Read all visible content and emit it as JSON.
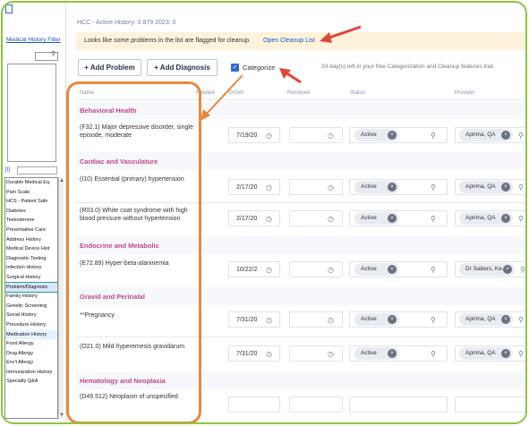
{
  "left_panel": {
    "link": "Medical History Filter",
    "at_label": "[t]",
    "items": [
      {
        "label": "Durable Medical Eq.",
        "state": "normal"
      },
      {
        "label": "Pain Scale",
        "state": "normal"
      },
      {
        "label": "HCS - Patient Safe",
        "state": "normal"
      },
      {
        "label": "Diabetes",
        "state": "normal"
      },
      {
        "label": "Testosterone",
        "state": "normal"
      },
      {
        "label": "Preventative Care",
        "state": "normal"
      },
      {
        "label": "Address History",
        "state": "normal"
      },
      {
        "label": "Medical Device Hist",
        "state": "normal"
      },
      {
        "label": "Diagnostic Testing",
        "state": "normal"
      },
      {
        "label": "Infection History",
        "state": "normal"
      },
      {
        "label": "Surgical History",
        "state": "normal"
      },
      {
        "label": "Problem/Diagnosis",
        "state": "selected"
      },
      {
        "label": "Family History",
        "state": "normal"
      },
      {
        "label": "Genetic Screening",
        "state": "normal"
      },
      {
        "label": "Social History",
        "state": "normal"
      },
      {
        "label": "Procedure History",
        "state": "normal"
      },
      {
        "label": "Medication History",
        "state": "highlight"
      },
      {
        "label": "Food Allergy",
        "state": "normal"
      },
      {
        "label": "Drug Allergy",
        "state": "normal"
      },
      {
        "label": "Env't Allergy",
        "state": "normal"
      },
      {
        "label": "Immunization History",
        "state": "normal"
      },
      {
        "label": "Specialty Q&A",
        "state": "normal"
      }
    ]
  },
  "header": {
    "hcc": "HCC - Active History: 0.879  2023: 0",
    "banner_text": "Looks like some problems in the list are flagged for cleanup.",
    "banner_link": "Open Cleanup List",
    "add_problem": "+ Add Problem",
    "add_diagnosis": "+ Add Diagnosis",
    "categorize": "Categorize",
    "trial_text": "33 day(s) left in your free Categorization and Cleanup features trial."
  },
  "columns": {
    "name": "Name",
    "related": "Related",
    "onset": "OnSet",
    "resolved": "Resolved",
    "status": "Status",
    "provider": "Provider"
  },
  "categories": [
    {
      "name": "Behavioral Health"
    },
    {
      "name": "Cardiac and Vasculature"
    },
    {
      "name": "Endocrine and Metabolic"
    },
    {
      "name": "Gravid and Perinatal"
    },
    {
      "name": "Hematology and Neoplasia"
    }
  ],
  "rows": [
    {
      "dx": "(F32.1) Major depressive disorder, single episode, moderate",
      "onset": "7/19/20",
      "status": "Active",
      "provider": "Aprima, QA"
    },
    {
      "dx": "(I10) Essential (primary) hypertension",
      "onset": "2/17/20",
      "status": "Active",
      "provider": "Aprima, QA"
    },
    {
      "dx": "(R03.0) White coat syndrome with high blood pressure without hypertension",
      "onset": "2/17/20",
      "status": "Active",
      "provider": "Aprima, QA"
    },
    {
      "dx": "(E72.89) Hyper-beta-alaninemia",
      "onset": "10/22/2",
      "status": "Active",
      "provider": "Dr Sabers, Ke..."
    },
    {
      "dx": "**Pregnancy",
      "onset": "7/31/20",
      "status": "Active",
      "provider": "Aprima, QA"
    },
    {
      "dx": "(O21.0) Mild hyperemesis gravidarum",
      "onset": "7/31/20",
      "status": "Active",
      "provider": "Aprima, QA"
    },
    {
      "dx": "(D49.512) Neoplasm of unspecified",
      "onset": "",
      "status": "",
      "provider": ""
    }
  ],
  "icons": {
    "clock": "clock-icon",
    "search": "search-icon",
    "clear": "clear-icon"
  },
  "colors": {
    "category": "#c0478a",
    "annotation": "#e8893a",
    "arrow": "#e0453a",
    "frame": "#8cc63f",
    "link": "#1a57b8"
  }
}
